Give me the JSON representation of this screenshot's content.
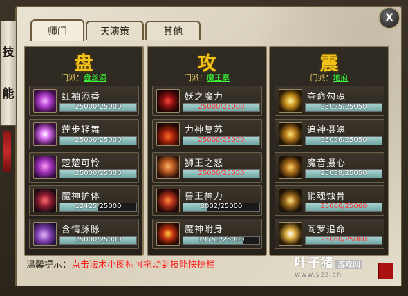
{
  "window": {
    "close_label": "X"
  },
  "left_banner": {
    "chars": [
      "技",
      "能"
    ]
  },
  "tabs": [
    {
      "label": "师门",
      "active": true
    },
    {
      "label": "天演策",
      "active": false
    },
    {
      "label": "其他",
      "active": false
    }
  ],
  "school_prefix": "门派：",
  "columns": [
    {
      "title": "盘",
      "school": "盘丝洞",
      "skills": [
        {
          "name": "红袖添香",
          "progress": "25000/25000",
          "fraction": 1.0,
          "red": false,
          "icon": "pink-swirl-icon"
        },
        {
          "name": "莲步轻舞",
          "progress": "25000/25000",
          "fraction": 1.0,
          "red": false,
          "icon": "pink-burst-icon"
        },
        {
          "name": "楚楚可怜",
          "progress": "25000/25000",
          "fraction": 1.0,
          "red": false,
          "icon": "pink-glow-icon"
        },
        {
          "name": "魔神护体",
          "progress": "12425/25000",
          "fraction": 0.497,
          "red": false,
          "icon": "demon-face-icon"
        },
        {
          "name": "含情脉脉",
          "progress": "25000/25000",
          "fraction": 1.0,
          "red": false,
          "icon": "pink-spark-icon"
        }
      ]
    },
    {
      "title": "攻",
      "school": "魔王寨",
      "skills": [
        {
          "name": "妖之魔力",
          "progress": "25000/25000",
          "fraction": 1.0,
          "red": true,
          "icon": "red-spiral-icon"
        },
        {
          "name": "力神复苏",
          "progress": "25000/25000",
          "fraction": 1.0,
          "red": true,
          "icon": "red-claw-icon"
        },
        {
          "name": "狮王之怒",
          "progress": "25000/25000",
          "fraction": 1.0,
          "red": true,
          "icon": "lion-icon"
        },
        {
          "name": "兽王神力",
          "progress": "8002/25000",
          "fraction": 0.32,
          "red": false,
          "icon": "beast-icon"
        },
        {
          "name": "魔神附身",
          "progress": "19753/25000",
          "fraction": 0.79,
          "red": false,
          "icon": "demon-mask-icon"
        }
      ]
    },
    {
      "title": "震",
      "school": "地府",
      "skills": [
        {
          "name": "夺命勾魂",
          "progress": "25025/25050",
          "fraction": 0.999,
          "red": false,
          "icon": "golden-ring-icon"
        },
        {
          "name": "追神摄魄",
          "progress": "25026/25050",
          "fraction": 0.999,
          "red": false,
          "icon": "golden-orb-icon"
        },
        {
          "name": "魔音摄心",
          "progress": "25039/25050",
          "fraction": 0.999,
          "red": false,
          "icon": "golden-swirl-icon"
        },
        {
          "name": "销魂蚀骨",
          "progress": "25060/25060",
          "fraction": 1.0,
          "red": true,
          "icon": "golden-serpent-icon"
        },
        {
          "name": "阎罗追命",
          "progress": "25060/25060",
          "fraction": 1.0,
          "red": true,
          "icon": "golden-star-icon"
        }
      ]
    }
  ],
  "hint": {
    "label": "温馨提示：",
    "text": "点击法术小图标可拖动到技能快捷栏"
  },
  "watermark": {
    "main": "叶子猪",
    "badge": "游戏网",
    "url": "www.yzz.cn"
  },
  "colors": {
    "title_gold": "#f3c21a",
    "school_link": "#3aff3a",
    "bar_fill": "#7fb5b1",
    "hint_red": "#ff1a1a"
  }
}
